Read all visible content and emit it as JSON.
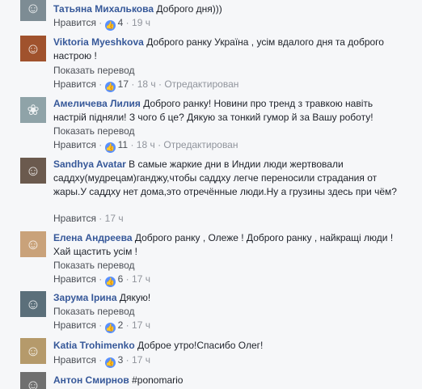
{
  "colors": {
    "author": "#365899",
    "link": "#4b4f56",
    "meta": "#90949c",
    "like": "#5890ff"
  },
  "comments": [
    {
      "author": "Татьяна Михалькова",
      "text": "Доброго дня)))",
      "like_label": "Нравится",
      "likes": "4",
      "time": "19 ч",
      "edited": "",
      "translate": ""
    },
    {
      "author": "Viktoria Myeshkova",
      "text": "Доброго ранку Україна , усім вдалого дня та доброго настрою !",
      "like_label": "Нравится",
      "likes": "17",
      "time": "18 ч",
      "edited": "Отредактирован",
      "translate": "Показать перевод"
    },
    {
      "author": "Амеличева Лилия",
      "text": "Доброго ранку! Новини про тренд з травкою навіть настрій підняли! З чого б це? Дякую за тонкий гумор й за Вашу роботу!",
      "like_label": "Нравится",
      "likes": "11",
      "time": "18 ч",
      "edited": "Отредактирован",
      "translate": "Показать перевод"
    },
    {
      "author": "Sandhya Avatar",
      "text": "В самые жаркие дни в Индии люди жертвовали саддху(мудрецам)ганджу,чтобы саддху легче переносили страдания от жары.У саддху нет дома,это отречённые люди.Ну а грузины здесь при чём?",
      "like_label": "Нравится",
      "likes": "",
      "time": "17 ч",
      "edited": "",
      "translate": ""
    },
    {
      "author": "Елена Андреева",
      "text": "Доброго ранку , Олеже ! Доброго ранку , найкращі люди ! Хай щастить усім !",
      "like_label": "Нравится",
      "likes": "6",
      "time": "17 ч",
      "edited": "",
      "translate": "Показать перевод"
    },
    {
      "author": "Зарума Ірина",
      "text": "Дякую!",
      "like_label": "Нравится",
      "likes": "2",
      "time": "17 ч",
      "edited": "",
      "translate": "Показать перевод"
    },
    {
      "author": "Katia Trohimenko",
      "text": "Доброе утро!Спасибо Олег!",
      "like_label": "Нравится",
      "likes": "3",
      "time": "17 ч",
      "edited": "",
      "translate": ""
    },
    {
      "author": "Антон Смирнов",
      "text": "#ponomario",
      "like_label": "",
      "likes": "",
      "time": "",
      "edited": "",
      "translate": ""
    }
  ]
}
